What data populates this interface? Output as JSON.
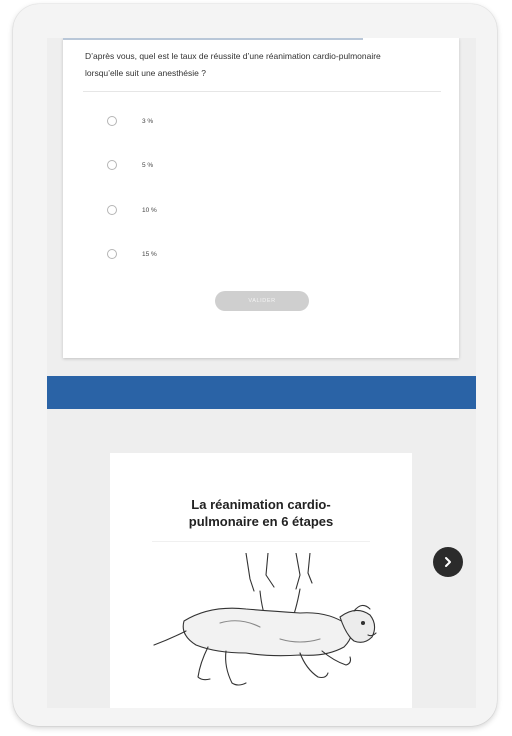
{
  "quiz": {
    "question_line1": "D’après vous, quel est le taux de réussite d’une réanimation cardio-pulmonaire",
    "question_line2": "lorsqu’elle suit une anesthésie ?",
    "options": [
      {
        "label": "3 %"
      },
      {
        "label": "5 %"
      },
      {
        "label": "10 %"
      },
      {
        "label": "15 %"
      }
    ],
    "submit_label": "VALIDER"
  },
  "carousel": {
    "title_line1": "La réanimation cardio-",
    "title_line2": "pulmonaire en 6 étapes",
    "next_icon": "chevron-right-icon"
  },
  "colors": {
    "band": "#2a63a6",
    "next_button": "#2b2b2b",
    "submit_disabled": "#cfcfcf"
  }
}
